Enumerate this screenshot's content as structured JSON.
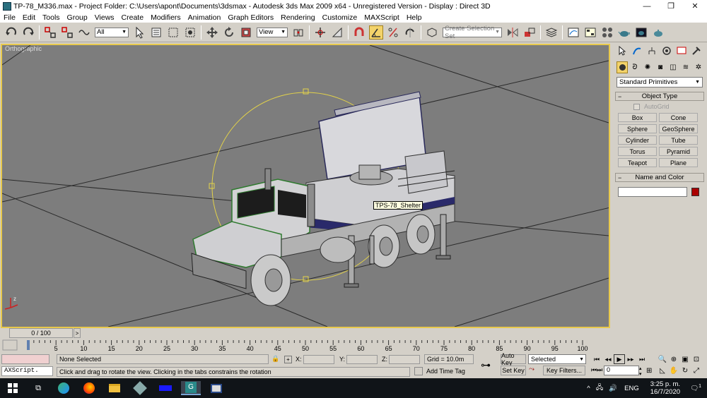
{
  "window": {
    "title": "TP-78_M336.max     - Project Folder: C:\\Users\\apont\\Documents\\3dsmax     - Autodesk 3ds Max  2009 x64  - Unregistered Version     - Display : Direct 3D",
    "minimize_icon": "minimize-icon",
    "maximize_icon": "restore-icon",
    "close_icon": "close-icon"
  },
  "menu": [
    "File",
    "Edit",
    "Tools",
    "Group",
    "Views",
    "Create",
    "Modifiers",
    "Animation",
    "Graph Editors",
    "Rendering",
    "Customize",
    "MAXScript",
    "Help"
  ],
  "toolbar": {
    "selection_filter": "All",
    "ref_coord": "View",
    "named_selection_placeholder": "Create Selection Set"
  },
  "viewport": {
    "label": "Orthographic",
    "tooltip": "TPS-78_Shelter",
    "axis_z": "z"
  },
  "command_panel": {
    "category": "Standard Primitives",
    "object_type_title": "Object Type",
    "autogrid_label": "AutoGrid",
    "primitives": [
      "Box",
      "Cone",
      "Sphere",
      "GeoSphere",
      "Cylinder",
      "Tube",
      "Torus",
      "Pyramid",
      "Teapot",
      "Plane"
    ],
    "name_color_title": "Name and Color",
    "object_color": "#a00000"
  },
  "time_slider": {
    "label": "0 / 100",
    "prev": "<",
    "next": ">"
  },
  "trackbar": {
    "ticks": [
      "5",
      "10",
      "15",
      "20",
      "25",
      "30",
      "35",
      "40",
      "45",
      "50",
      "55",
      "60",
      "65",
      "70",
      "75",
      "80",
      "85",
      "90",
      "95",
      "100"
    ]
  },
  "status": {
    "script_listener": "AXScript.",
    "selection_status": "None Selected",
    "prompt": "Click and drag to rotate the view.  Clicking in the tabs constrains the rotation",
    "x_label": "X:",
    "y_label": "Y:",
    "z_label": "Z:",
    "grid": "Grid = 10.0m",
    "add_time_tag": "Add Time Tag",
    "auto_key": "Auto Key",
    "set_key": "Set Key",
    "key_mode": "Selected",
    "key_filters": "Key Filters...",
    "current_frame": "0"
  },
  "taskbar": {
    "language": "ENG",
    "time": "3:25 p. m.",
    "date": "16/7/2020",
    "notifications": "1"
  }
}
